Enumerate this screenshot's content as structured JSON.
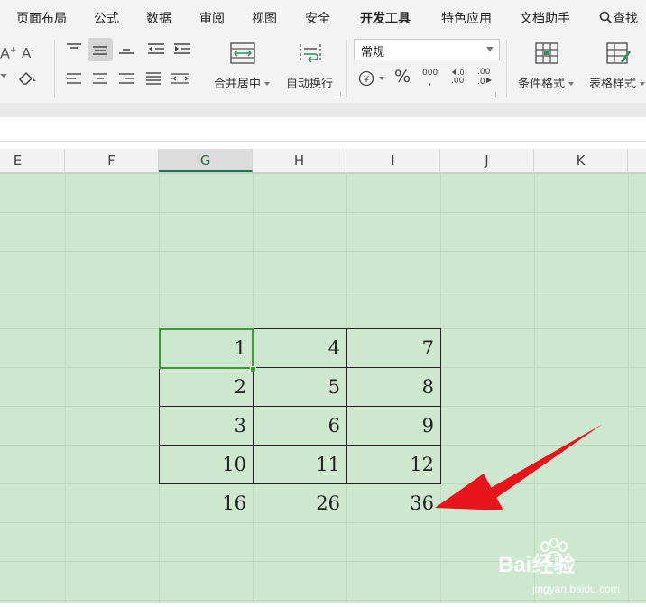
{
  "menu": {
    "items": [
      "页面布局",
      "公式",
      "数据",
      "审阅",
      "视图",
      "安全",
      "开发工具",
      "特色应用",
      "文档助手"
    ],
    "search_label": "查找"
  },
  "ribbon": {
    "merge_center_label": "合并居中",
    "wrap_text_label": "自动换行",
    "number_format_value": "常规",
    "conditional_format_label": "条件格式",
    "table_style_label": "表格样式",
    "percent_symbol": "%",
    "thousands_label": "000",
    "increase_decimal_label": ".00",
    "decrease_decimal_label": ".0"
  },
  "columns": [
    "E",
    "F",
    "G",
    "H",
    "I",
    "J",
    "K"
  ],
  "active_column": "G",
  "table": {
    "rows": [
      [
        "1",
        "4",
        "7"
      ],
      [
        "2",
        "5",
        "8"
      ],
      [
        "3",
        "6",
        "9"
      ],
      [
        "10",
        "11",
        "12"
      ]
    ],
    "sums": [
      "16",
      "26",
      "36"
    ]
  },
  "watermark": {
    "brand": "Bai经验",
    "url": "jingyan.baidu.com"
  },
  "colors": {
    "sheet_background": "#cde8cf",
    "selection": "#3d9a3d",
    "arrow": "#e8141c"
  }
}
